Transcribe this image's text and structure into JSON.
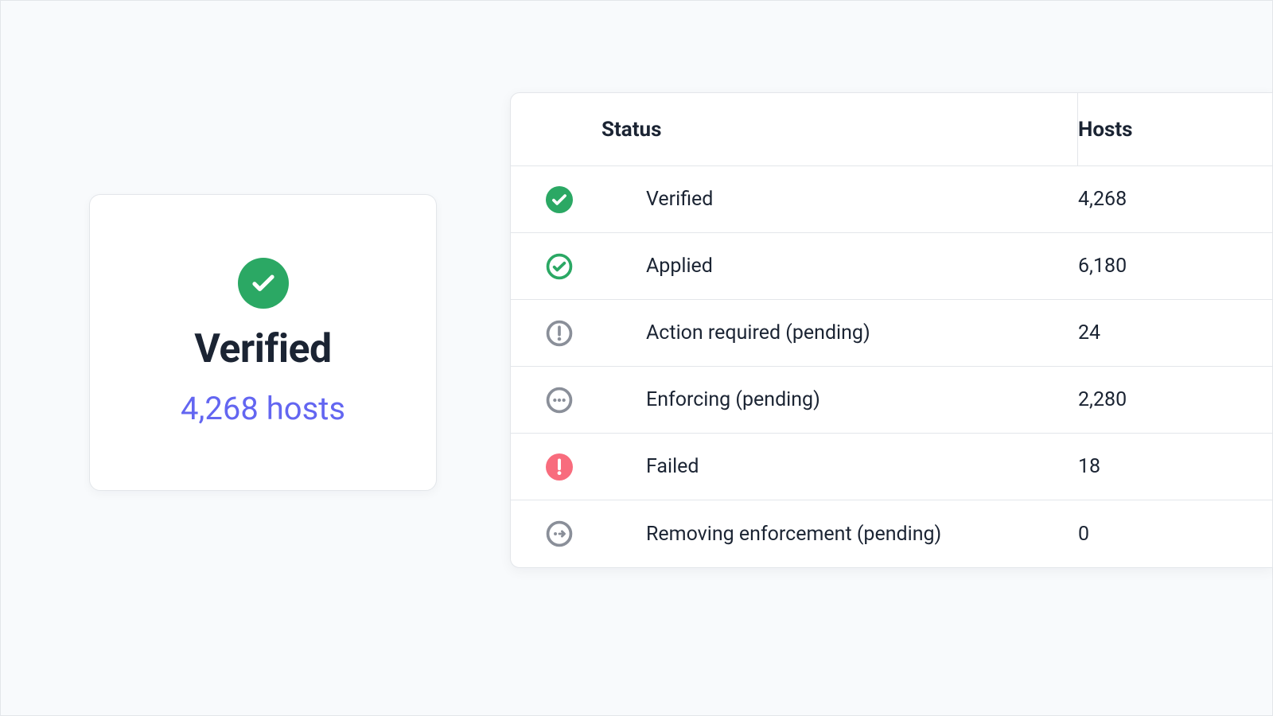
{
  "summary": {
    "icon": "check-solid",
    "title": "Verified",
    "hosts_text": "4,268 hosts"
  },
  "table": {
    "headers": {
      "status": "Status",
      "hosts": "Hosts"
    },
    "rows": [
      {
        "icon": "check-solid",
        "label": "Verified",
        "hosts": "4,268"
      },
      {
        "icon": "check-outline",
        "label": "Applied",
        "hosts": "6,180"
      },
      {
        "icon": "alert-outline",
        "label": "Action required (pending)",
        "hosts": "24"
      },
      {
        "icon": "dots-outline",
        "label": "Enforcing (pending)",
        "hosts": "2,280"
      },
      {
        "icon": "alert-solid",
        "label": "Failed",
        "hosts": "18"
      },
      {
        "icon": "arrow-outline",
        "label": "Removing enforcement (pending)",
        "hosts": "0"
      }
    ]
  },
  "colors": {
    "green": "#2ba864",
    "red": "#f86c7d",
    "gray": "#8a8f99",
    "indigo": "#6366f1",
    "text": "#1b2433"
  }
}
